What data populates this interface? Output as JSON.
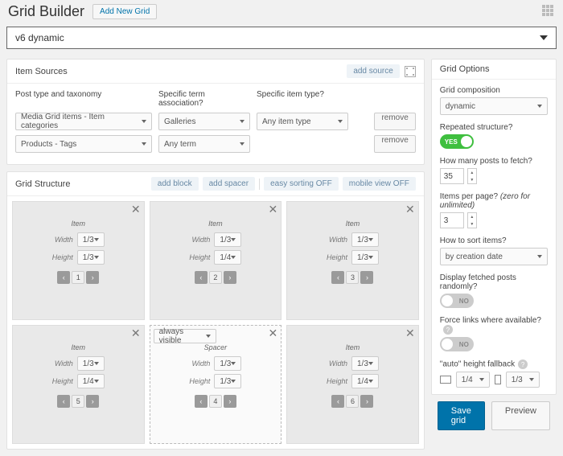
{
  "header": {
    "title": "Grid Builder",
    "add_new": "Add New Grid"
  },
  "selector": {
    "value": "v6 dynamic"
  },
  "item_sources": {
    "title": "Item Sources",
    "add_source": "add source",
    "cols": [
      "Post type and taxonomy",
      "Specific term association?",
      "Specific item type?"
    ],
    "rows": [
      {
        "pt": "Media Grid items - Item categories",
        "term": "Galleries",
        "type": "Any item type",
        "remove": "remove"
      },
      {
        "pt": "Products - Tags",
        "term": "Any term",
        "type": "",
        "remove": "remove"
      }
    ]
  },
  "structure": {
    "title": "Grid Structure",
    "actions": {
      "add_block": "add block",
      "add_spacer": "add spacer",
      "easy_sorting": "easy sorting OFF",
      "mobile_view": "mobile view OFF"
    },
    "item_label": "Item",
    "spacer_label": "Spacer",
    "width_label": "Width",
    "height_label": "Height",
    "always_visible": "always visible",
    "cells": [
      {
        "kind": "item",
        "w": "1/3",
        "h": "1/3",
        "page": 1
      },
      {
        "kind": "item",
        "w": "1/3",
        "h": "1/4",
        "page": 2
      },
      {
        "kind": "item",
        "w": "1/3",
        "h": "1/3",
        "page": 3
      },
      {
        "kind": "spacer",
        "w": "1/3",
        "h": "1/3",
        "page": 4
      },
      {
        "kind": "item",
        "w": "1/3",
        "h": "1/4",
        "page": 5
      },
      {
        "kind": "item",
        "w": "1/3",
        "h": "1/4",
        "page": 6
      }
    ]
  },
  "options": {
    "title": "Grid Options",
    "composition": {
      "label": "Grid composition",
      "value": "dynamic"
    },
    "repeated": {
      "label": "Repeated structure?",
      "value": "YES"
    },
    "posts_fetch": {
      "label": "How many posts to fetch?",
      "value": "35"
    },
    "per_page": {
      "label": "Items per page?",
      "hint": "(zero for unlimited)",
      "value": "3"
    },
    "sort": {
      "label": "How to sort items?",
      "value": "by creation date"
    },
    "random": {
      "label": "Display fetched posts randomly?",
      "value": "NO"
    },
    "force_links": {
      "label": "Force links where available?",
      "value": "NO"
    },
    "fallback": {
      "label": "\"auto\" height fallback",
      "desktop": "1/4",
      "mobile": "1/3"
    }
  },
  "footer": {
    "save": "Save grid",
    "preview": "Preview"
  }
}
